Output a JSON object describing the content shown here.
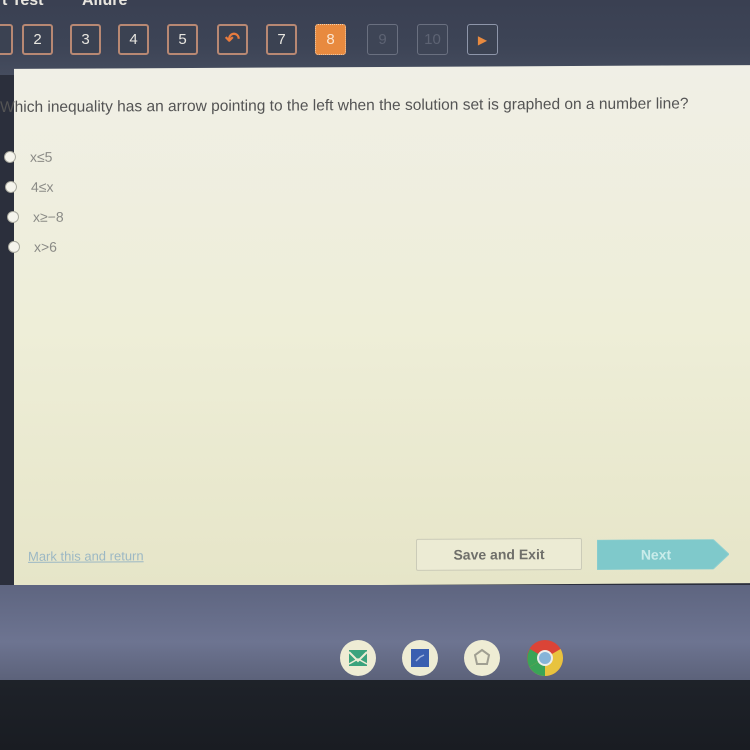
{
  "header": {
    "title_left": "t Test",
    "title_right": "Ailure"
  },
  "question_nav": {
    "buttons": [
      {
        "label": "",
        "state": "answered"
      },
      {
        "label": "2",
        "state": "answered"
      },
      {
        "label": "3",
        "state": "answered"
      },
      {
        "label": "4",
        "state": "answered"
      },
      {
        "label": "5",
        "state": "answered"
      },
      {
        "label": "",
        "icon": "return-arrow-icon",
        "state": "flagged"
      },
      {
        "label": "7",
        "state": "answered"
      },
      {
        "label": "8",
        "state": "current"
      },
      {
        "label": "9",
        "state": "disabled"
      },
      {
        "label": "10",
        "state": "disabled"
      },
      {
        "label": "",
        "icon": "play-arrow-icon",
        "state": "next-page"
      }
    ],
    "flag_glyph": "↶",
    "next_glyph": "▶"
  },
  "question": {
    "text": "Which inequality has an arrow pointing to the left when the solution set is graphed on a number line?",
    "options": [
      {
        "label": "x≤5",
        "selected": false
      },
      {
        "label": "4≤x",
        "selected": false
      },
      {
        "label": "x≥−8",
        "selected": false
      },
      {
        "label": "x>6",
        "selected": false
      }
    ]
  },
  "footer": {
    "mark_link": "Mark this and return",
    "save_label": "Save and Exit",
    "next_label": "Next"
  },
  "shelf": {
    "apps": [
      {
        "name": "classroom-app-icon",
        "color": "#3aa37d"
      },
      {
        "name": "files-app-icon",
        "color": "#3a5fb0"
      },
      {
        "name": "settings-app-icon",
        "color": "#9a9a90"
      },
      {
        "name": "chrome-icon",
        "color": "#db4437"
      }
    ]
  }
}
